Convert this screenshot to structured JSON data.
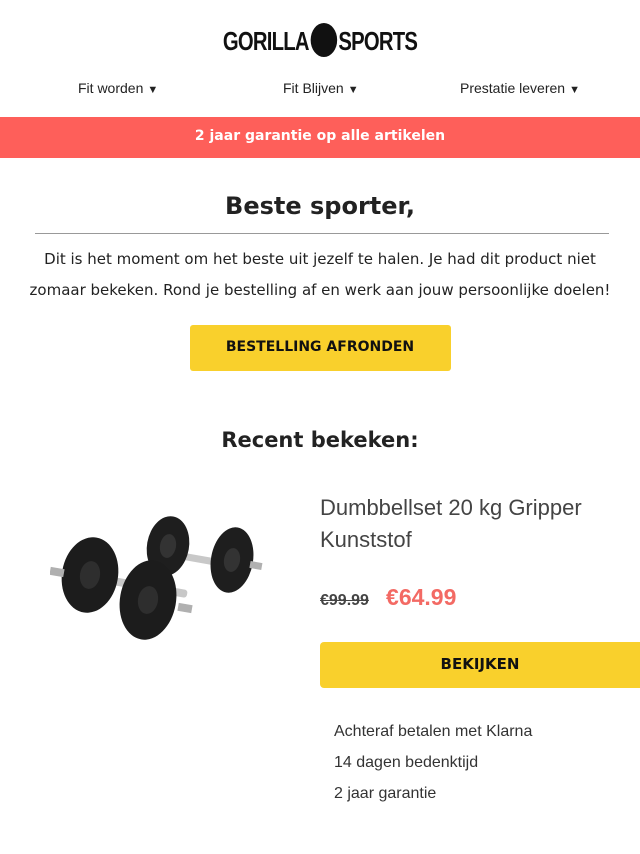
{
  "header": {
    "logo_left": "GORILLA",
    "logo_right": "SPORTS"
  },
  "nav": {
    "items": [
      {
        "label": "Fit worden",
        "caret": "▼"
      },
      {
        "label": "Fit Blijven",
        "caret": "▼"
      },
      {
        "label": "Prestatie leveren",
        "caret": "▼"
      }
    ]
  },
  "banner": {
    "text": "2 jaar garantie op alle artikelen",
    "color": "#fe5f5a"
  },
  "greeting": {
    "title": "Beste sporter,",
    "body": "Dit is het moment om het beste uit jezelf te halen. Je had dit product niet zomaar bekeken. Rond je bestelling af en werk aan jouw persoonlijke doelen!"
  },
  "cta": {
    "label": "BESTELLING AFRONDEN",
    "color": "#f9d02c"
  },
  "recent": {
    "heading": "Recent bekeken:"
  },
  "product": {
    "title": "Dumbbellset 20 kg Gripper Kunststof",
    "old_price": "€99.99",
    "new_price": "€64.99",
    "button_label": "BEKIJKEN",
    "image_icon": "dumbbell-set-image",
    "benefits": [
      "Achteraf betalen met Klarna",
      "14 dagen bedenktijd",
      "2 jaar garantie"
    ]
  }
}
